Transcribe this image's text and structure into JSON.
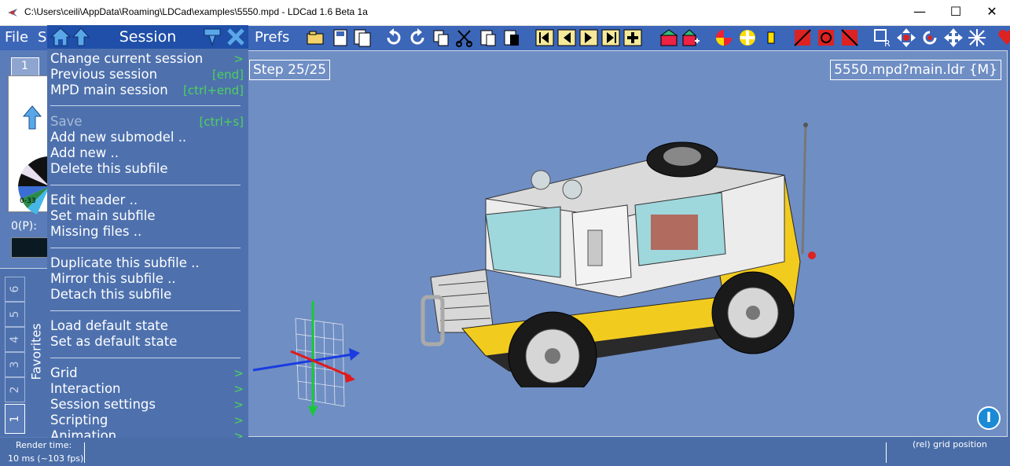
{
  "window": {
    "title": "C:\\Users\\ceili\\AppData\\Roaming\\LDCad\\examples\\5550.mpd - LDCad 1.6 Beta 1a",
    "minimize": "—",
    "maximize": "☐",
    "close": "✕"
  },
  "menubar": {
    "file": "File",
    "s": "S",
    "prefs": "Prefs"
  },
  "session_menu": {
    "title": "Session",
    "items": [
      {
        "label": "Change current session",
        "shortcut": ">"
      },
      {
        "label": "Previous session",
        "shortcut": "[end]"
      },
      {
        "label": "MPD main session",
        "shortcut": "[ctrl+end]"
      },
      {
        "label": "Save",
        "shortcut": "[ctrl+s]"
      },
      {
        "label": "Add new submodel ..",
        "shortcut": ""
      },
      {
        "label": "Add new ..",
        "shortcut": ""
      },
      {
        "label": "Delete this subfile",
        "shortcut": ""
      },
      {
        "label": "Edit header ..",
        "shortcut": ""
      },
      {
        "label": "Set main subfile",
        "shortcut": ""
      },
      {
        "label": "Missing files ..",
        "shortcut": ""
      },
      {
        "label": "Duplicate this subfile ..",
        "shortcut": ""
      },
      {
        "label": "Mirror this subfile ..",
        "shortcut": ""
      },
      {
        "label": "Detach this subfile",
        "shortcut": ""
      },
      {
        "label": "Load default state",
        "shortcut": ""
      },
      {
        "label": "Set as default state",
        "shortcut": ""
      },
      {
        "label": "Grid",
        "shortcut": ">"
      },
      {
        "label": "Interaction",
        "shortcut": ">"
      },
      {
        "label": "Session settings",
        "shortcut": ">"
      },
      {
        "label": "Scripting",
        "shortcut": ">"
      },
      {
        "label": "Animation",
        "shortcut": ">"
      }
    ]
  },
  "left_panel": {
    "top_tab": "1",
    "range": "0-33",
    "part_label": "0(P):",
    "favorites": "Favorites",
    "tabs": [
      "6",
      "5",
      "4",
      "3",
      "2",
      "1"
    ]
  },
  "viewport": {
    "step": "Step 25/25",
    "file": "5550.mpd?main.ldr {M}",
    "info_icon": "I"
  },
  "status": {
    "render_label": "Render time:",
    "render_value": "10 ms (~103 fps)",
    "grid": "(rel) grid position"
  },
  "colors": {
    "accent": "#3c66b8",
    "menu_bg": "#4e71ae",
    "viewport_bg": "#6f8ec4",
    "shortcut": "#4cd25a"
  }
}
